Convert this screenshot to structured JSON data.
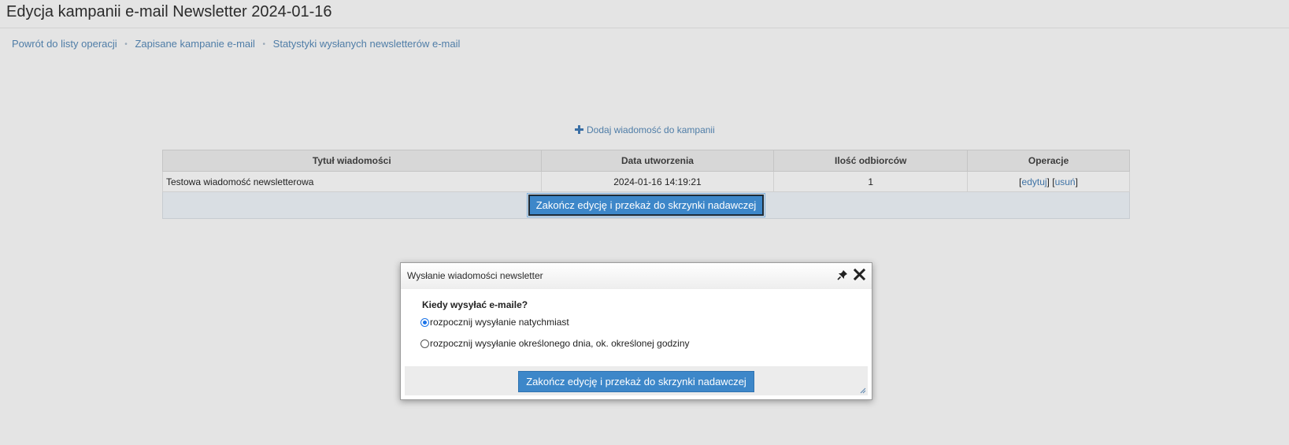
{
  "page": {
    "title": "Edycja kampanii e-mail Newsletter 2024-01-16"
  },
  "breadcrumb": {
    "items": [
      {
        "label": "Powrót do listy operacji"
      },
      {
        "label": "Zapisane kampanie e-mail"
      },
      {
        "label": "Statystyki wysłanych newsletterów e-mail"
      }
    ],
    "separator": "•"
  },
  "add_message": {
    "label": "Dodaj wiadomość do kampanii",
    "icon": "plus-icon"
  },
  "table": {
    "headers": [
      "Tytuł wiadomości",
      "Data utworzenia",
      "Ilość odbiorców",
      "Operacje"
    ],
    "rows": [
      {
        "title": "Testowa wiadomość newsletterowa",
        "created": "2024-01-16 14:19:21",
        "recipients": "1",
        "op_edit": "edytuj",
        "op_delete": "usuń"
      }
    ],
    "finish_button": "Zakończ edycję i przekaż do skrzynki nadawczej"
  },
  "dialog": {
    "title": "Wysłanie wiadomości newsletter",
    "question": "Kiedy wysyłać e-maile?",
    "options": [
      {
        "label": "rozpocznij wysyłanie natychmiast",
        "checked": true
      },
      {
        "label": "rozpocznij wysyłanie określonego dnia, ok. określonej godziny",
        "checked": false
      }
    ],
    "submit_button": "Zakończ edycję i przekaż do skrzynki nadawczej"
  },
  "colors": {
    "background": "#e4e4e4",
    "link": "#4f7da7",
    "button": "#3d87c9"
  }
}
